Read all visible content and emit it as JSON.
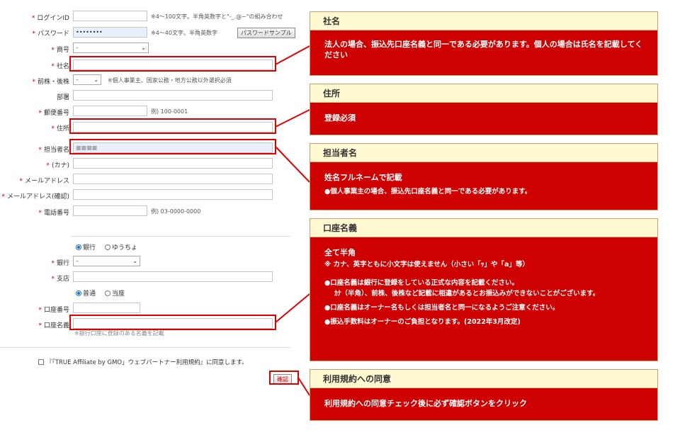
{
  "form": {
    "login_id": {
      "label": "ログインID",
      "note": "※4～100文字。半角英数字と\"-_.@~\"の組み合わせ"
    },
    "password": {
      "label": "パスワード",
      "value": "••••••••",
      "note": "※4～40文字。半角英数字",
      "sample_button": "パスワードサンプル"
    },
    "trade_name": {
      "label": "商号",
      "value": "–"
    },
    "company": {
      "label": "社名"
    },
    "prefix": {
      "label": "前株・後株",
      "value": "–",
      "note": "※個人事業主、国家公務・地方公務以外選択必須"
    },
    "department": {
      "label": "部署"
    },
    "postal": {
      "label": "郵便番号",
      "note": "例) 100-0001"
    },
    "address": {
      "label": "住所"
    },
    "contact": {
      "label": "担当者名",
      "value": "■■■■"
    },
    "kana": {
      "label": "(カナ)"
    },
    "email": {
      "label": "メールアドレス"
    },
    "email_confirm": {
      "label": "メールアドレス(確認)"
    },
    "phone": {
      "label": "電話番号",
      "note": "例) 03-0000-0000"
    },
    "bank_type": {
      "bank": "銀行",
      "yucho": "ゆうちょ"
    },
    "bank": {
      "label": "銀行",
      "value": "–"
    },
    "branch": {
      "label": "支店"
    },
    "account_type": {
      "futsu": "普通",
      "toza": "当座"
    },
    "account_no": {
      "label": "口座番号"
    },
    "account_name": {
      "label": "口座名義",
      "note": "※銀行口座に登録のある名義を記載"
    },
    "agree": {
      "text": "『「TRUE Affiliate by GMO」ウェブパートナー利用規約』に同意します。"
    },
    "confirm_button": "確認",
    "required_mark": "*"
  },
  "panels": {
    "company": {
      "title": "社名",
      "body": "法人の場合、振込先口座名義と同一である必要があります。個人の場合は氏名を記載してください"
    },
    "address": {
      "title": "住所",
      "body": "登録必須"
    },
    "contact": {
      "title": "担当者名",
      "body": "姓名フルネームで記載",
      "bullet": "●個人事業主の場合、振込先口座名義と同一である必要があります。"
    },
    "account": {
      "title": "口座名義",
      "body1": "全て半角",
      "body2": "※ カナ、英字ともに小文字は使えません（小さい「ｯ」や「a」等）",
      "bullet1": "●口座名義は銀行に登録をしている正式な内容を記載ください。",
      "bullet1b": "ｶﾅ（半角）、前株、後株など記載に相違があるとお振込みができないことがございます。",
      "bullet2": "●口座名義はオーナー名もしくは担当者名と同一になるようご注意ください。",
      "bullet3": "●振込手数料はオーナーのご負担となります。(2022年3月改定)"
    },
    "terms": {
      "title": "利用規約への同意",
      "body": "利用規約への同意チェック後に必ず確認ボタンをクリック"
    }
  },
  "colors": {
    "accent": "#cf0000",
    "panel_header": "#fff8d0",
    "highlight": "#e00000"
  }
}
